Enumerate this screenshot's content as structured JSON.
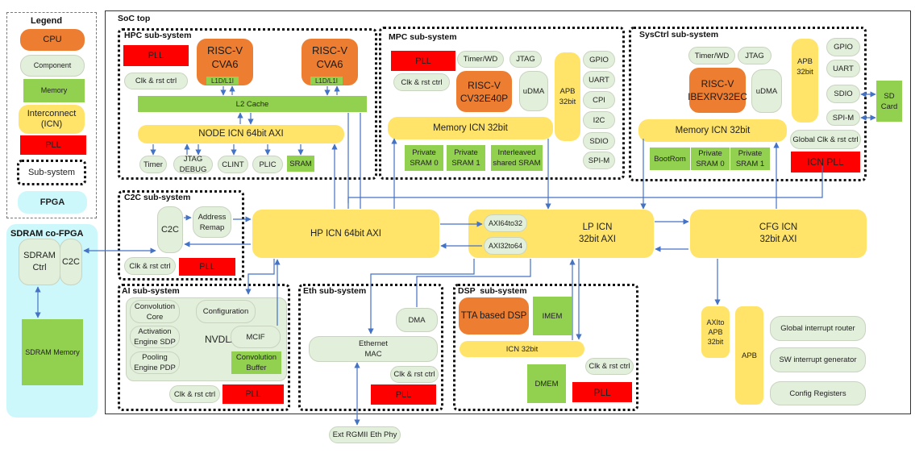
{
  "legend": {
    "title": "Legend",
    "items": {
      "cpu": "CPU",
      "component": "Component",
      "memory": "Memory",
      "icn": "Interconnect (ICN)",
      "pll": "PLL",
      "subsystem": "Sub-system",
      "fpga": "FPGA"
    }
  },
  "colors": {
    "cpu": "#ED7D31",
    "component": "#E2EFDA",
    "memory": "#92D050",
    "icn": "#FFE469",
    "pll": "#FF0000",
    "fpga": "#CCF8FC",
    "wire": "#4472C4"
  },
  "sdram_fpga": {
    "title": "SDRAM co-FPGA",
    "sdram_ctrl": "SDRAM Ctrl",
    "c2c": "C2C",
    "sdram_memory": "SDRAM Memory"
  },
  "soc": {
    "title": "SoC top",
    "hpc": {
      "title": "HPC sub-system",
      "pll": "PLL",
      "clk": "Clk & rst ctrl",
      "cpu0": "RISC-V CVA6",
      "cpu1": "RISC-V CVA6",
      "l1_0": "L1D/L1I",
      "l1_1": "L1D/L1I",
      "l2": "L2 Cache",
      "node_icn": "NODE ICN 64bit AXI",
      "peripherals": [
        "Timer",
        "JTAG DEBUG",
        "CLINT",
        "PLIC"
      ],
      "sram": "SRAM"
    },
    "mpc": {
      "title": "MPC sub-system",
      "pll": "PLL",
      "timer": "Timer/WD",
      "jtag": "JTAG",
      "clk": "Clk & rst ctrl",
      "cpu": "RISC-V CV32E40P",
      "udma": "uDMA",
      "apb": "APB 32bit",
      "peripherals": [
        "GPIO",
        "UART",
        "CPI",
        "I2C",
        "SDIO",
        "SPI-M"
      ],
      "mem_icn": "Memory ICN 32bit",
      "memories": [
        "Private SRAM 0",
        "Private SRAM 1",
        "Interleaved shared SRAM"
      ]
    },
    "sysctrl": {
      "title": "SysCtrl sub-system",
      "timer": "Timer/WD",
      "jtag": "JTAG",
      "cpu": "RISC-V IBEXRV32EC",
      "udma": "uDMA",
      "apb": "APB 32bit",
      "peripherals": [
        "GPIO",
        "UART",
        "SDIO",
        "SPI-M"
      ],
      "mem_icn": "Memory ICN 32bit",
      "memories": [
        "BootRom",
        "Private SRAM 0",
        "Private SRAM 1"
      ],
      "global_clk": "Global Clk & rst ctrl",
      "icn_pll": "ICN PLL"
    },
    "sd_card": "SD Card",
    "c2c": {
      "title": "C2C sub-system",
      "c2c": "C2C",
      "remap": "Address Remap",
      "clk": "Clk & rst ctrl",
      "pll": "PLL"
    },
    "hp_icn": "HP ICN 64bit AXI",
    "lp_icn": "LP ICN 32bit AXI",
    "axi64to32": "AXI64to32",
    "axi32to64": "AXI32to64",
    "cfg_icn": "CFG ICN 32bit AXI",
    "ai": {
      "title": "AI sub-system",
      "nvdla": "NVDLA",
      "conv_core": "Convolution Core",
      "config": "Configuration",
      "sdp": "Activation Engine SDP",
      "mcif": "MCIF",
      "pdp": "Pooling Engine PDP",
      "conv_buf": "Convolution Buffer",
      "clk": "Clk & rst ctrl",
      "pll": "PLL"
    },
    "eth": {
      "title": "Eth sub-system",
      "dma": "DMA",
      "mac": "Ethernet MAC",
      "clk": "Clk & rst ctrl",
      "pll": "PLL"
    },
    "dsp": {
      "title": "DSP  sub-system",
      "dsp": "TTA based DSP",
      "imem": "IMEM",
      "icn": "ICN 32bit",
      "clk": "Clk & rst ctrl",
      "dmem": "DMEM",
      "pll": "PLL"
    },
    "cfg_periph": {
      "axi2apb": "AXIto APB 32bit",
      "apb": "APB",
      "items": [
        "Global interrupt router",
        "SW interrupt generator",
        "Config Registers"
      ]
    }
  },
  "ext_phy": "Ext RGMII Eth Phy"
}
